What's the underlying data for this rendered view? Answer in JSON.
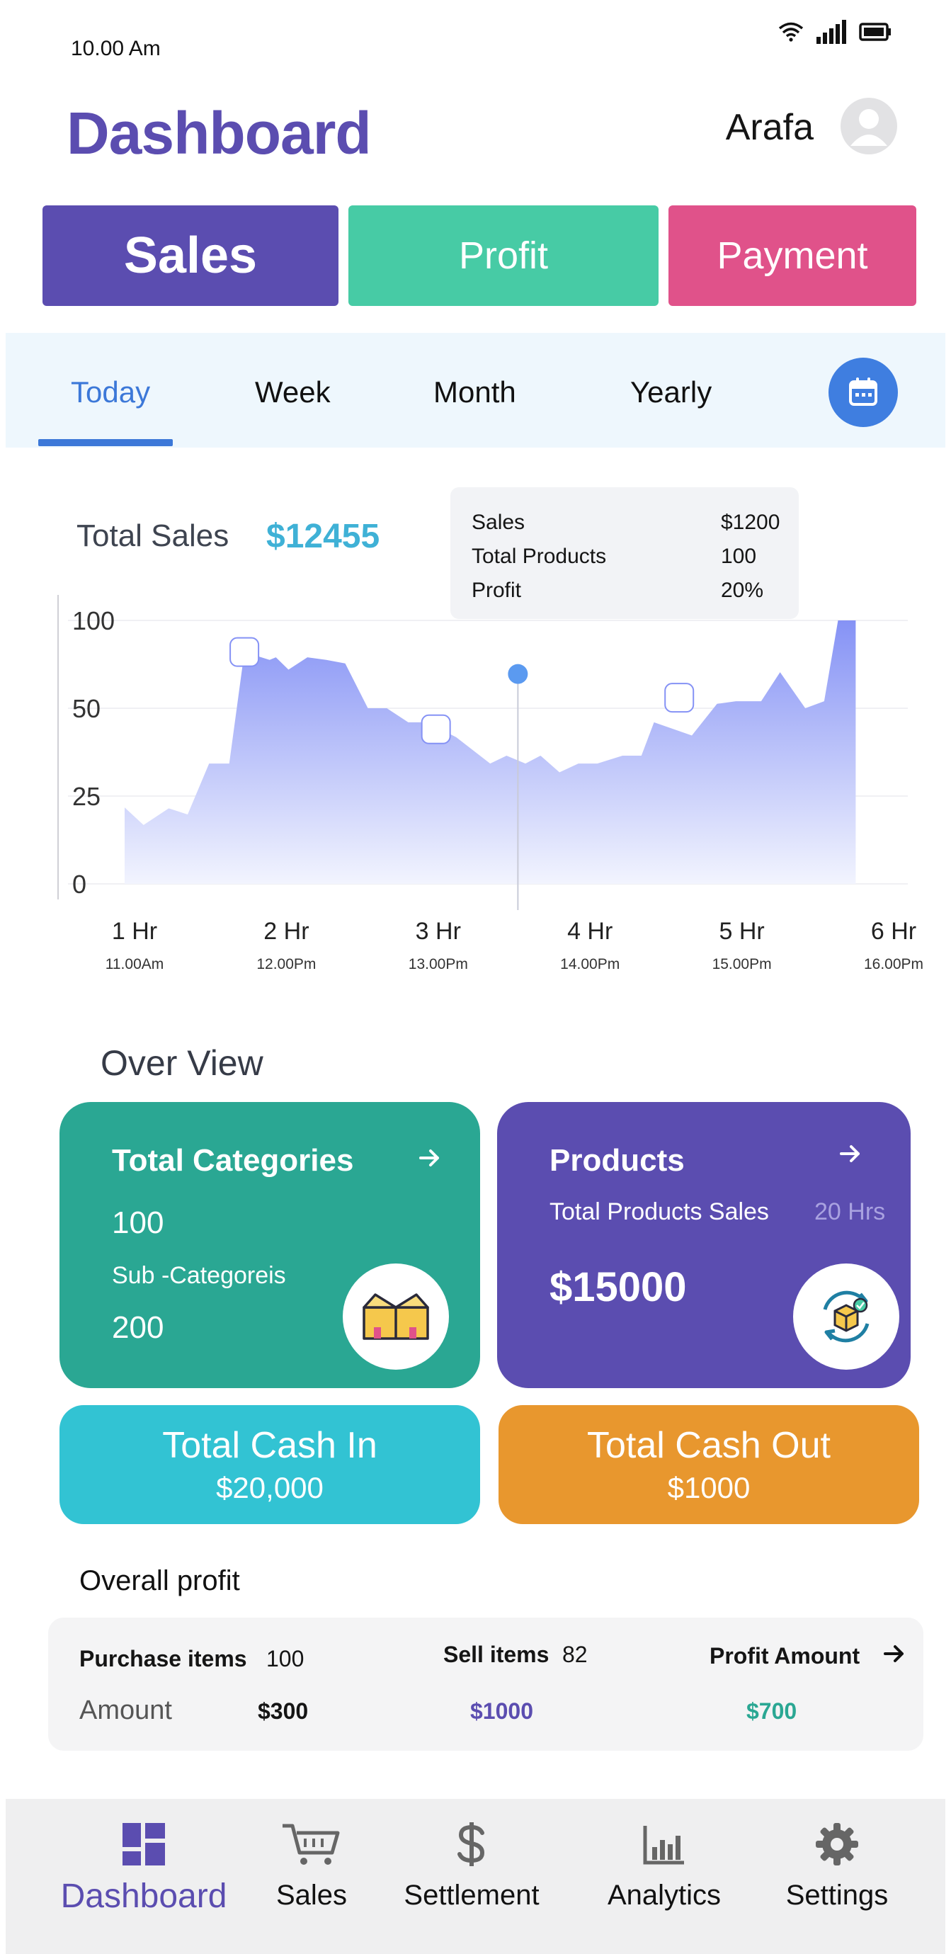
{
  "status_bar": {
    "time": "10.00 Am",
    "icons": [
      "wifi-icon",
      "signal-icon",
      "battery-icon"
    ]
  },
  "header": {
    "title": "Dashboard",
    "user_name": "Arafa"
  },
  "top_tabs": {
    "sales": "Sales",
    "profit": "Profit",
    "payment": "Payment"
  },
  "periods": {
    "today": "Today",
    "week": "Week",
    "month": "Month",
    "yearly": "Yearly",
    "active": "Today"
  },
  "summary": {
    "label": "Total Sales",
    "value": "$12455"
  },
  "tooltip": {
    "rows": [
      {
        "label": "Sales",
        "value": "$1200"
      },
      {
        "label": "Total Products",
        "value": "100"
      },
      {
        "label": "Profit",
        "value": "20%"
      }
    ]
  },
  "chart_data": {
    "type": "area",
    "y_ticks": [
      "100",
      "50",
      "25",
      "0"
    ],
    "x_labels": [
      {
        "label": "1 Hr",
        "sub": "11.00Am"
      },
      {
        "label": "2 Hr",
        "sub": "12.00Pm"
      },
      {
        "label": "3 Hr",
        "sub": "13.00Pm"
      },
      {
        "label": "4 Hr",
        "sub": "14.00Pm"
      },
      {
        "label": "5 Hr",
        "sub": "15.00Pm"
      },
      {
        "label": "6 Hr",
        "sub": "16.00Pm"
      }
    ],
    "x_range": [
      0,
      6
    ],
    "y_range": [
      0,
      3
    ],
    "grid": true,
    "series": [
      {
        "values": [
          [
            0.0,
            0.87
          ],
          [
            0.15,
            0.67
          ],
          [
            0.35,
            0.86
          ],
          [
            0.5,
            0.79
          ],
          [
            0.67,
            1.37
          ],
          [
            0.83,
            1.37
          ],
          [
            0.95,
            2.64
          ],
          [
            1.15,
            2.55
          ],
          [
            1.2,
            2.58
          ],
          [
            1.3,
            2.44
          ],
          [
            1.45,
            2.58
          ],
          [
            1.6,
            2.55
          ],
          [
            1.75,
            2.51
          ],
          [
            1.93,
            2.0
          ],
          [
            2.08,
            2.0
          ],
          [
            2.25,
            1.84
          ],
          [
            2.4,
            1.84
          ],
          [
            2.63,
            1.67
          ],
          [
            2.9,
            1.37
          ],
          [
            3.03,
            1.46
          ],
          [
            3.18,
            1.37
          ],
          [
            3.3,
            1.46
          ],
          [
            3.45,
            1.27
          ],
          [
            3.6,
            1.37
          ],
          [
            3.75,
            1.37
          ],
          [
            3.95,
            1.46
          ],
          [
            4.1,
            1.46
          ],
          [
            4.2,
            1.84
          ],
          [
            4.5,
            1.69
          ],
          [
            4.7,
            2.05
          ],
          [
            4.85,
            2.08
          ],
          [
            5.05,
            2.08
          ],
          [
            5.2,
            2.41
          ],
          [
            5.4,
            2.0
          ],
          [
            5.55,
            2.08
          ],
          [
            5.66,
            3.0
          ],
          [
            5.8,
            3.0
          ]
        ],
        "markers": [
          [
            0.95,
            2.64
          ],
          [
            2.47,
            1.76
          ],
          [
            4.4,
            2.12
          ]
        ],
        "highlight_x": 3.12,
        "highlight_y": 2.39
      }
    ],
    "colors": {
      "fill_top": "#8592f5",
      "fill_bottom": "#f2f4fe"
    }
  },
  "overview": {
    "title": "Over View",
    "categories": {
      "title": "Total Categories",
      "count": "100",
      "sub_label": "Sub -Categoreis",
      "sub_count": "200",
      "icon": "box-icon"
    },
    "products": {
      "title": "Products",
      "sub_label": "Total Products Sales",
      "hours": "20 Hrs",
      "amount": "$15000",
      "icon": "product-cycle-icon"
    },
    "cash_in": {
      "title": "Total Cash In",
      "value": "$20,000"
    },
    "cash_out": {
      "title": "Total Cash Out",
      "value": "$1000"
    }
  },
  "overall_profit": {
    "title": "Overall profit",
    "purchase_label": "Purchase items",
    "purchase_count": "100",
    "sell_label": "Sell items",
    "sell_count": "82",
    "profit_label": "Profit Amount",
    "amount_label": "Amount",
    "purchase_amount": "$300",
    "sell_amount": "$1000",
    "profit_amount": "$700"
  },
  "bottom_nav": {
    "items": [
      {
        "label": "Dashboard",
        "icon": "dashboard-icon"
      },
      {
        "label": "Sales",
        "icon": "cart-icon"
      },
      {
        "label": "Settlement",
        "icon": "dollar-icon"
      },
      {
        "label": "Analytics",
        "icon": "bar-chart-icon"
      },
      {
        "label": "Settings",
        "icon": "gear-icon"
      }
    ]
  },
  "colors": {
    "primary": "#5b4db0",
    "teal": "#47cba5",
    "pink": "#e0528a",
    "blue": "#3c78d8",
    "cyan": "#32c3d3",
    "orange": "#e8972e",
    "green": "#2aa793"
  }
}
